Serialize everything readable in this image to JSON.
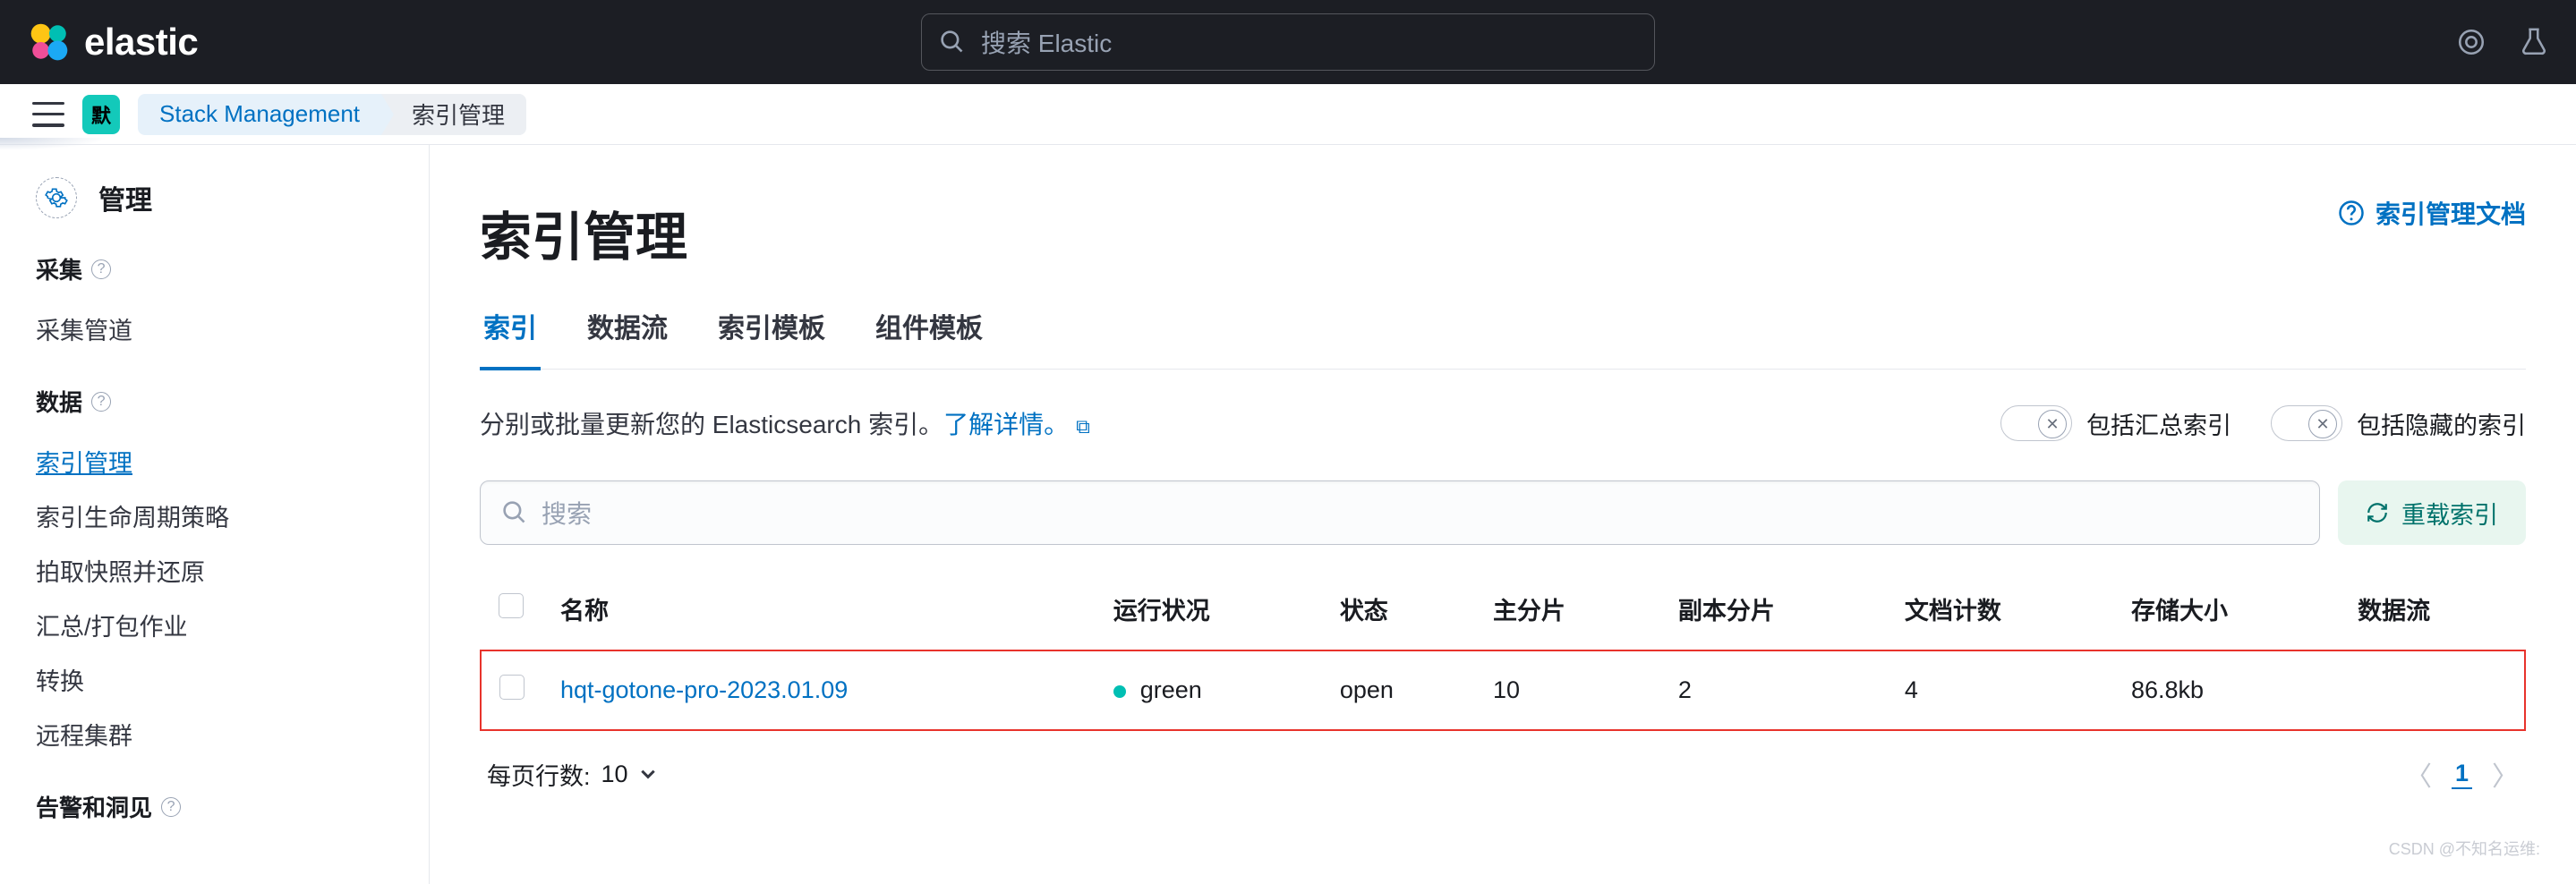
{
  "header": {
    "logo_text": "elastic",
    "search_placeholder": "搜索 Elastic"
  },
  "breadcrumb": {
    "space_badge": "默",
    "items": [
      "Stack Management",
      "索引管理"
    ]
  },
  "sidebar": {
    "header": "管理",
    "sections": [
      {
        "title": "采集",
        "items": [
          "采集管道"
        ]
      },
      {
        "title": "数据",
        "items": [
          "索引管理",
          "索引生命周期策略",
          "拍取快照并还原",
          "汇总/打包作业",
          "转换",
          "远程集群"
        ]
      },
      {
        "title": "告警和洞见",
        "items": []
      }
    ],
    "active_item": "索引管理"
  },
  "page": {
    "title": "索引管理",
    "docs_link": "索引管理文档",
    "tabs": [
      "索引",
      "数据流",
      "索引模板",
      "组件模板"
    ],
    "active_tab": "索引",
    "description_prefix": "分别或批量更新您的 Elasticsearch 索引。",
    "description_link": "了解详情。",
    "switches": [
      {
        "label": "包括汇总索引",
        "on": false
      },
      {
        "label": "包括隐藏的索引",
        "on": false
      }
    ],
    "search_placeholder": "搜索",
    "reload_label": "重载索引"
  },
  "table": {
    "columns": [
      "名称",
      "运行状况",
      "状态",
      "主分片",
      "副本分片",
      "文档计数",
      "存储大小",
      "数据流"
    ],
    "rows": [
      {
        "name": "hqt-gotone-pro-2023.01.09",
        "health": "green",
        "status": "open",
        "primary": "10",
        "replica": "2",
        "docs": "4",
        "size": "86.8kb",
        "stream": ""
      }
    ]
  },
  "pagination": {
    "rows_label": "每页行数: ",
    "rows_value": "10",
    "current_page": "1"
  },
  "watermark": "CSDN @不知名运维:"
}
